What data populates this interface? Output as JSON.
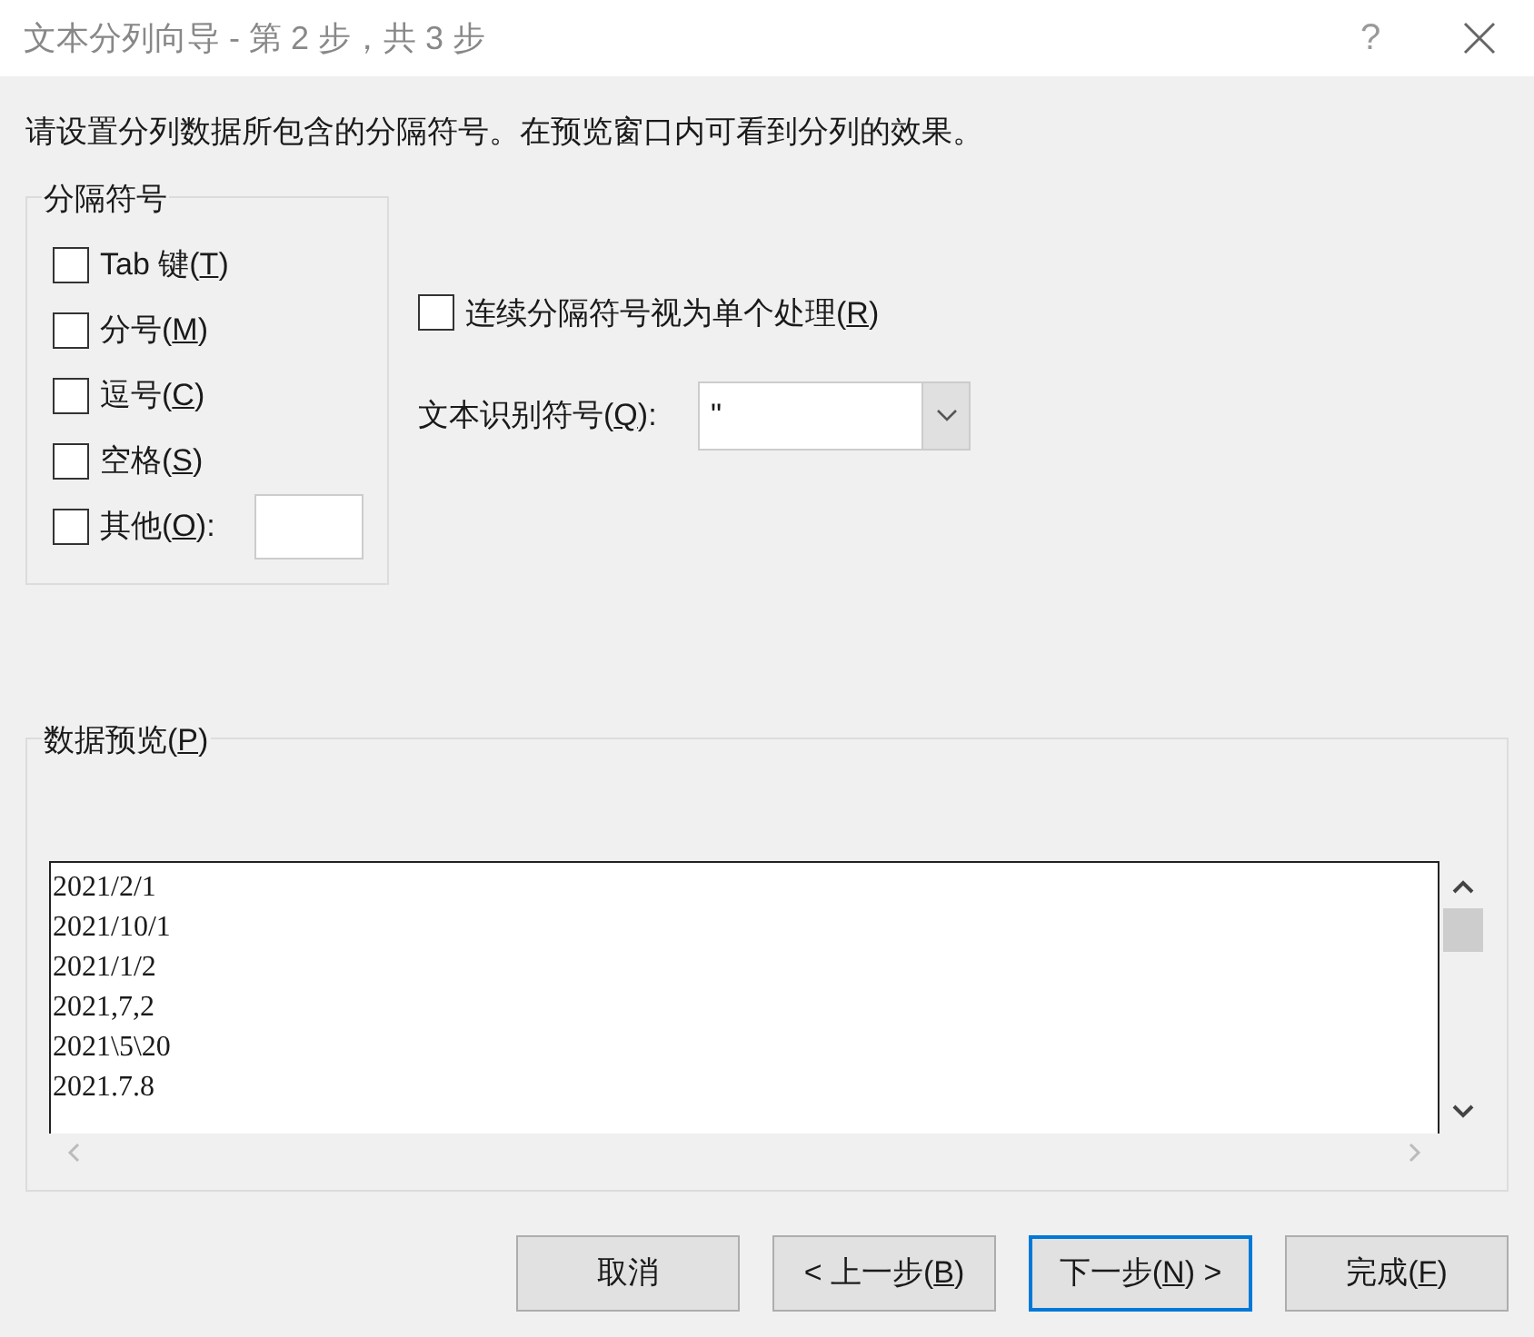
{
  "window": {
    "title": "文本分列向导 - 第 2 步，共 3 步",
    "help": "?"
  },
  "instruction": "请设置分列数据所包含的分隔符号。在预览窗口内可看到分列的效果。",
  "delimiters": {
    "legend": "分隔符号",
    "items": [
      {
        "label": {
          "pre": "Tab 键(",
          "key": "T",
          "post": ")"
        },
        "checked": false
      },
      {
        "label": {
          "pre": "分号(",
          "key": "M",
          "post": ")"
        },
        "checked": false
      },
      {
        "label": {
          "pre": "逗号(",
          "key": "C",
          "post": ")"
        },
        "checked": false
      },
      {
        "label": {
          "pre": "空格(",
          "key": "S",
          "post": ")"
        },
        "checked": false
      },
      {
        "label": {
          "pre": "其他(",
          "key": "O",
          "post": "):"
        },
        "checked": false,
        "kind": "other"
      }
    ]
  },
  "consecutive": {
    "label": {
      "pre": "连续分隔符号视为单个处理(",
      "key": "R",
      "post": ")"
    },
    "checked": false
  },
  "qualifier": {
    "label": {
      "pre": "文本识别符号(",
      "key": "Q",
      "post": "):"
    },
    "value": "\""
  },
  "preview": {
    "legend": {
      "pre": "数据预览(",
      "key": "P",
      "post": ")"
    },
    "rows": [
      "2021/2/1",
      "2021/10/1",
      "2021/1/2",
      "2021,7,2",
      "2021\\5\\20",
      "2021.7.8"
    ]
  },
  "buttons": [
    {
      "label": {
        "pre": "取消"
      },
      "selected": false
    },
    {
      "label": {
        "pre": "< 上一步(",
        "key": "B",
        "post": ")"
      },
      "selected": false
    },
    {
      "label": {
        "pre": "下一步(",
        "key": "N",
        "post": ") >"
      },
      "selected": true
    },
    {
      "label": {
        "pre": "完成(",
        "key": "F",
        "post": ")"
      },
      "selected": false
    }
  ]
}
